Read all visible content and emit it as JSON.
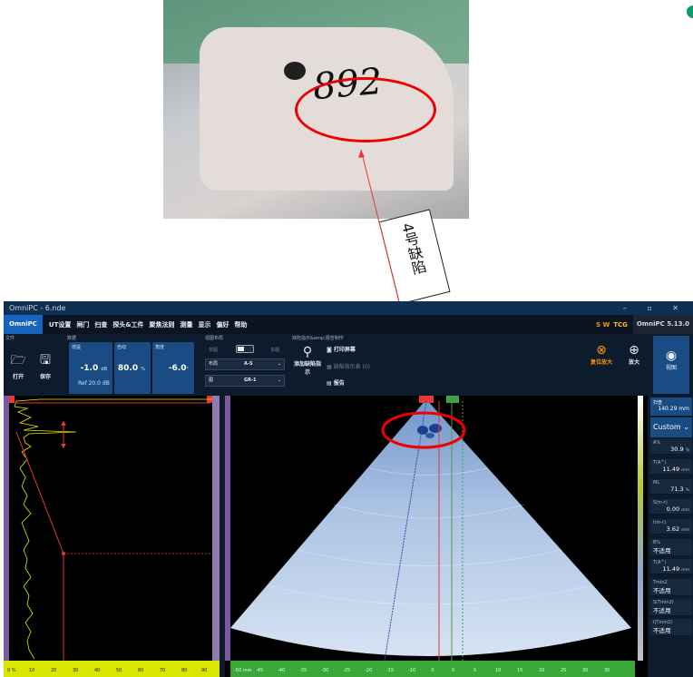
{
  "photo": {
    "marking_text": "892"
  },
  "callout": {
    "text": "4号缺陷"
  },
  "window": {
    "title": "OmniPC - 6.nde"
  },
  "menu": {
    "brand": "OmniPC",
    "items": [
      "UT设置",
      "闸门",
      "扫查",
      "探头&工件",
      "聚焦法则",
      "测量",
      "显示",
      "偏好",
      "帮助"
    ],
    "sw": "S W",
    "tcg": "TCG",
    "version": "OmniPC 5.13.0"
  },
  "ribbon": {
    "file_group": "文件",
    "open": "打开",
    "save": "保存",
    "data_group": "数据",
    "gain_label": "增益",
    "gain_value": "-1.0",
    "gain_unit": "dB",
    "gain_ref": "Ref 20.0",
    "gain_ref_unit": "dB",
    "auto_label": "自动",
    "auto_value": "80.0",
    "auto_unit": "%",
    "angle_label": "角度",
    "angle_value": "-6.0",
    "angle_unit": "°",
    "layout_group": "视图布局",
    "single": "单图",
    "multi": "多图",
    "layout_label": "布局",
    "layout_value": "A-S",
    "chart_label": "图",
    "chart_value": "GR-1",
    "report_group": "缺陷指示&amp;报告制作",
    "add_indication": "添加缺陷指示",
    "print_screen": "打印屏幕",
    "indication_table": "缺陷指示表 (0)",
    "report": "报告",
    "reset_zoom": "复位放大",
    "zoom": "放大",
    "view": "视图"
  },
  "left_axis_ticks": [
    "0 %",
    "10",
    "20",
    "30",
    "40",
    "50",
    "60",
    "70",
    "80",
    "90"
  ],
  "center_axis_ticks": [
    "-50 mm",
    "-45",
    "-40",
    "-35",
    "-30",
    "-25",
    "-20",
    "-15",
    "-10",
    "-5",
    "0",
    "5",
    "10",
    "15",
    "20",
    "25",
    "30",
    "35"
  ],
  "right_panel": {
    "scan_label": "扫查",
    "scan_value": "140.29 mm",
    "preset": "Custom",
    "readings": [
      {
        "label": "A%",
        "value": "30.9",
        "unit": "%"
      },
      {
        "label": "T(A^)",
        "value": "11.49",
        "unit": "mm"
      },
      {
        "label": "ML",
        "value": "71.3",
        "unit": "%"
      },
      {
        "label": "S(m-r)",
        "value": "0.00",
        "unit": "mm"
      },
      {
        "label": "I(m-r)",
        "value": "3.62",
        "unit": "mm"
      },
      {
        "label": "B%",
        "value": "不适用",
        "unit": ""
      },
      {
        "label": "T(A^)",
        "value": "11.49",
        "unit": "mm"
      },
      {
        "label": "Tmin2",
        "value": "不适用",
        "unit": ""
      },
      {
        "label": "S(Tmin2)",
        "value": "不适用",
        "unit": ""
      },
      {
        "label": "I(Tmin2)",
        "value": "不适用",
        "unit": ""
      }
    ]
  },
  "colors": {
    "accent": "#1565c0",
    "gate_red": "#e53935",
    "gate_green": "#43a047",
    "ascan": "#e6e600"
  }
}
